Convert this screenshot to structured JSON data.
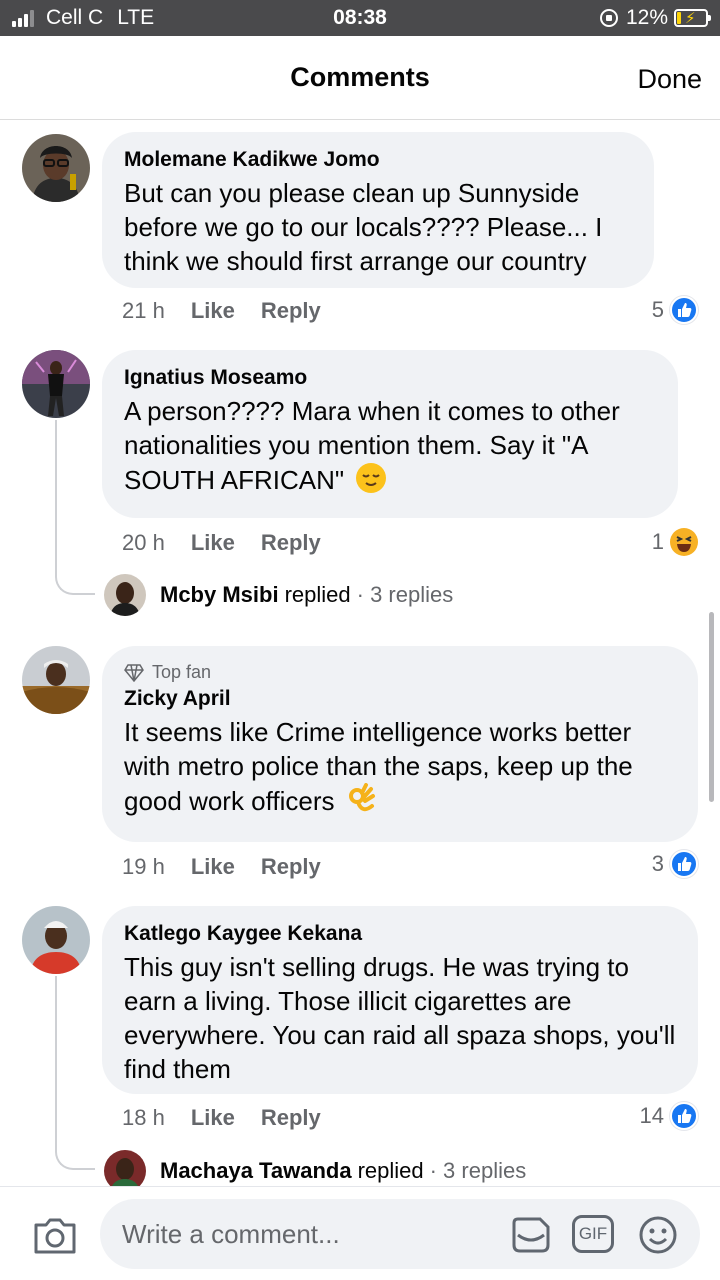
{
  "status_bar": {
    "carrier": "Cell C",
    "network": "LTE",
    "time": "08:38",
    "battery": "12%",
    "icons": [
      "signal-icon",
      "rotation-lock-icon",
      "battery-charging-icon"
    ]
  },
  "header": {
    "title": "Comments",
    "done_label": "Done"
  },
  "comments": [
    {
      "author": "Molemane Kadikwe Jomo",
      "text": "But can you please clean up Sunnyside before we go to our locals???? Please... I think we should first arrange our country",
      "time": "21 h",
      "like_label": "Like",
      "reply_label": "Reply",
      "reaction_count": "5",
      "reaction": "like-icon"
    },
    {
      "author": "Ignatius Moseamo",
      "text": "A person???? Mara when it comes to other nationalities you mention them. Say it \"A SOUTH AFRICAN\"",
      "emoji": "relieved-face-emoji",
      "time": "20 h",
      "like_label": "Like",
      "reply_label": "Reply",
      "reaction_count": "1",
      "reaction": "haha-icon",
      "reply_preview": {
        "name": "Mcby Msibi",
        "action": "replied",
        "count": "· 3 replies"
      }
    },
    {
      "badge": "Top fan",
      "author": "Zicky April",
      "text": "It seems like Crime intelligence works better with metro police than the saps, keep up the good work officers",
      "emoji": "ok-hand-emoji",
      "time": "19 h",
      "like_label": "Like",
      "reply_label": "Reply",
      "reaction_count": "3",
      "reaction": "like-icon"
    },
    {
      "author": "Katlego Kaygee Kekana",
      "text": "This guy isn't selling drugs. He was trying to earn a living. Those illicit cigarettes are everywhere. You can raid all spaza shops, you'll find them",
      "time": "18 h",
      "like_label": "Like",
      "reply_label": "Reply",
      "reaction_count": "14",
      "reaction": "like-icon",
      "reply_preview": {
        "name": "Machaya Tawanda",
        "action": "replied",
        "count": "· 3 replies"
      }
    }
  ],
  "composer": {
    "placeholder": "Write a comment...",
    "gif_label": "GIF"
  },
  "colors": {
    "like_blue": "#1877f2",
    "bubble": "#f0f2f5",
    "muted": "#65676b"
  }
}
